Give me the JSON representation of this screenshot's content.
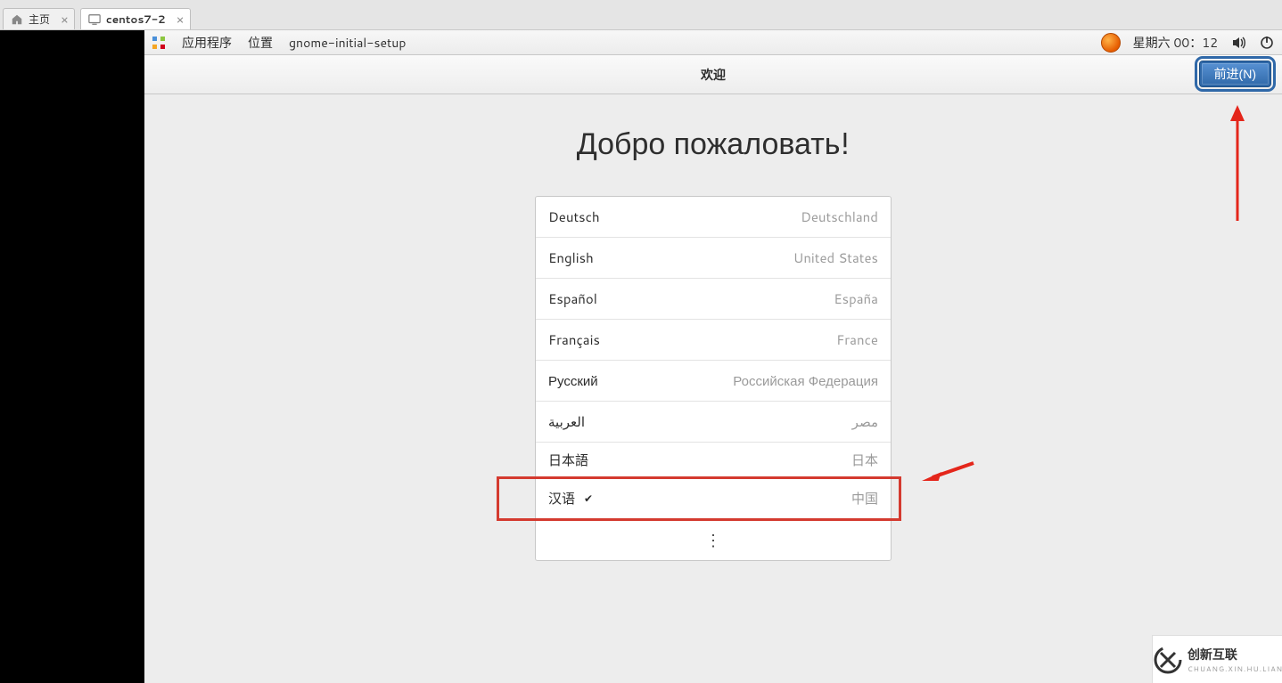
{
  "tabs": {
    "home_label": "主页",
    "vm_label": "centos7-2"
  },
  "gnome_top": {
    "applications": "应用程序",
    "places": "位置",
    "app_name": "gnome-initial-setup",
    "datetime": "星期六 00：12"
  },
  "welcome_bar": {
    "title": "欢迎",
    "next_button": "前进(N)"
  },
  "heading": "Добро пожаловать!",
  "languages": [
    {
      "name": "Deutsch",
      "country": "Deutschland",
      "checked": false
    },
    {
      "name": "English",
      "country": "United States",
      "checked": false
    },
    {
      "name": "Español",
      "country": "España",
      "checked": false
    },
    {
      "name": "Français",
      "country": "France",
      "checked": false
    },
    {
      "name": "Русский",
      "country": "Российская Федерация",
      "checked": false
    },
    {
      "name": "العربية",
      "country": "مصر",
      "checked": false
    },
    {
      "name": "日本語",
      "country": "日本",
      "checked": false
    },
    {
      "name": "汉语",
      "country": "中国",
      "checked": true
    }
  ],
  "watermark": {
    "brand": "创新互联",
    "sub": "CHUANG.XIN.HU.LIAN"
  }
}
